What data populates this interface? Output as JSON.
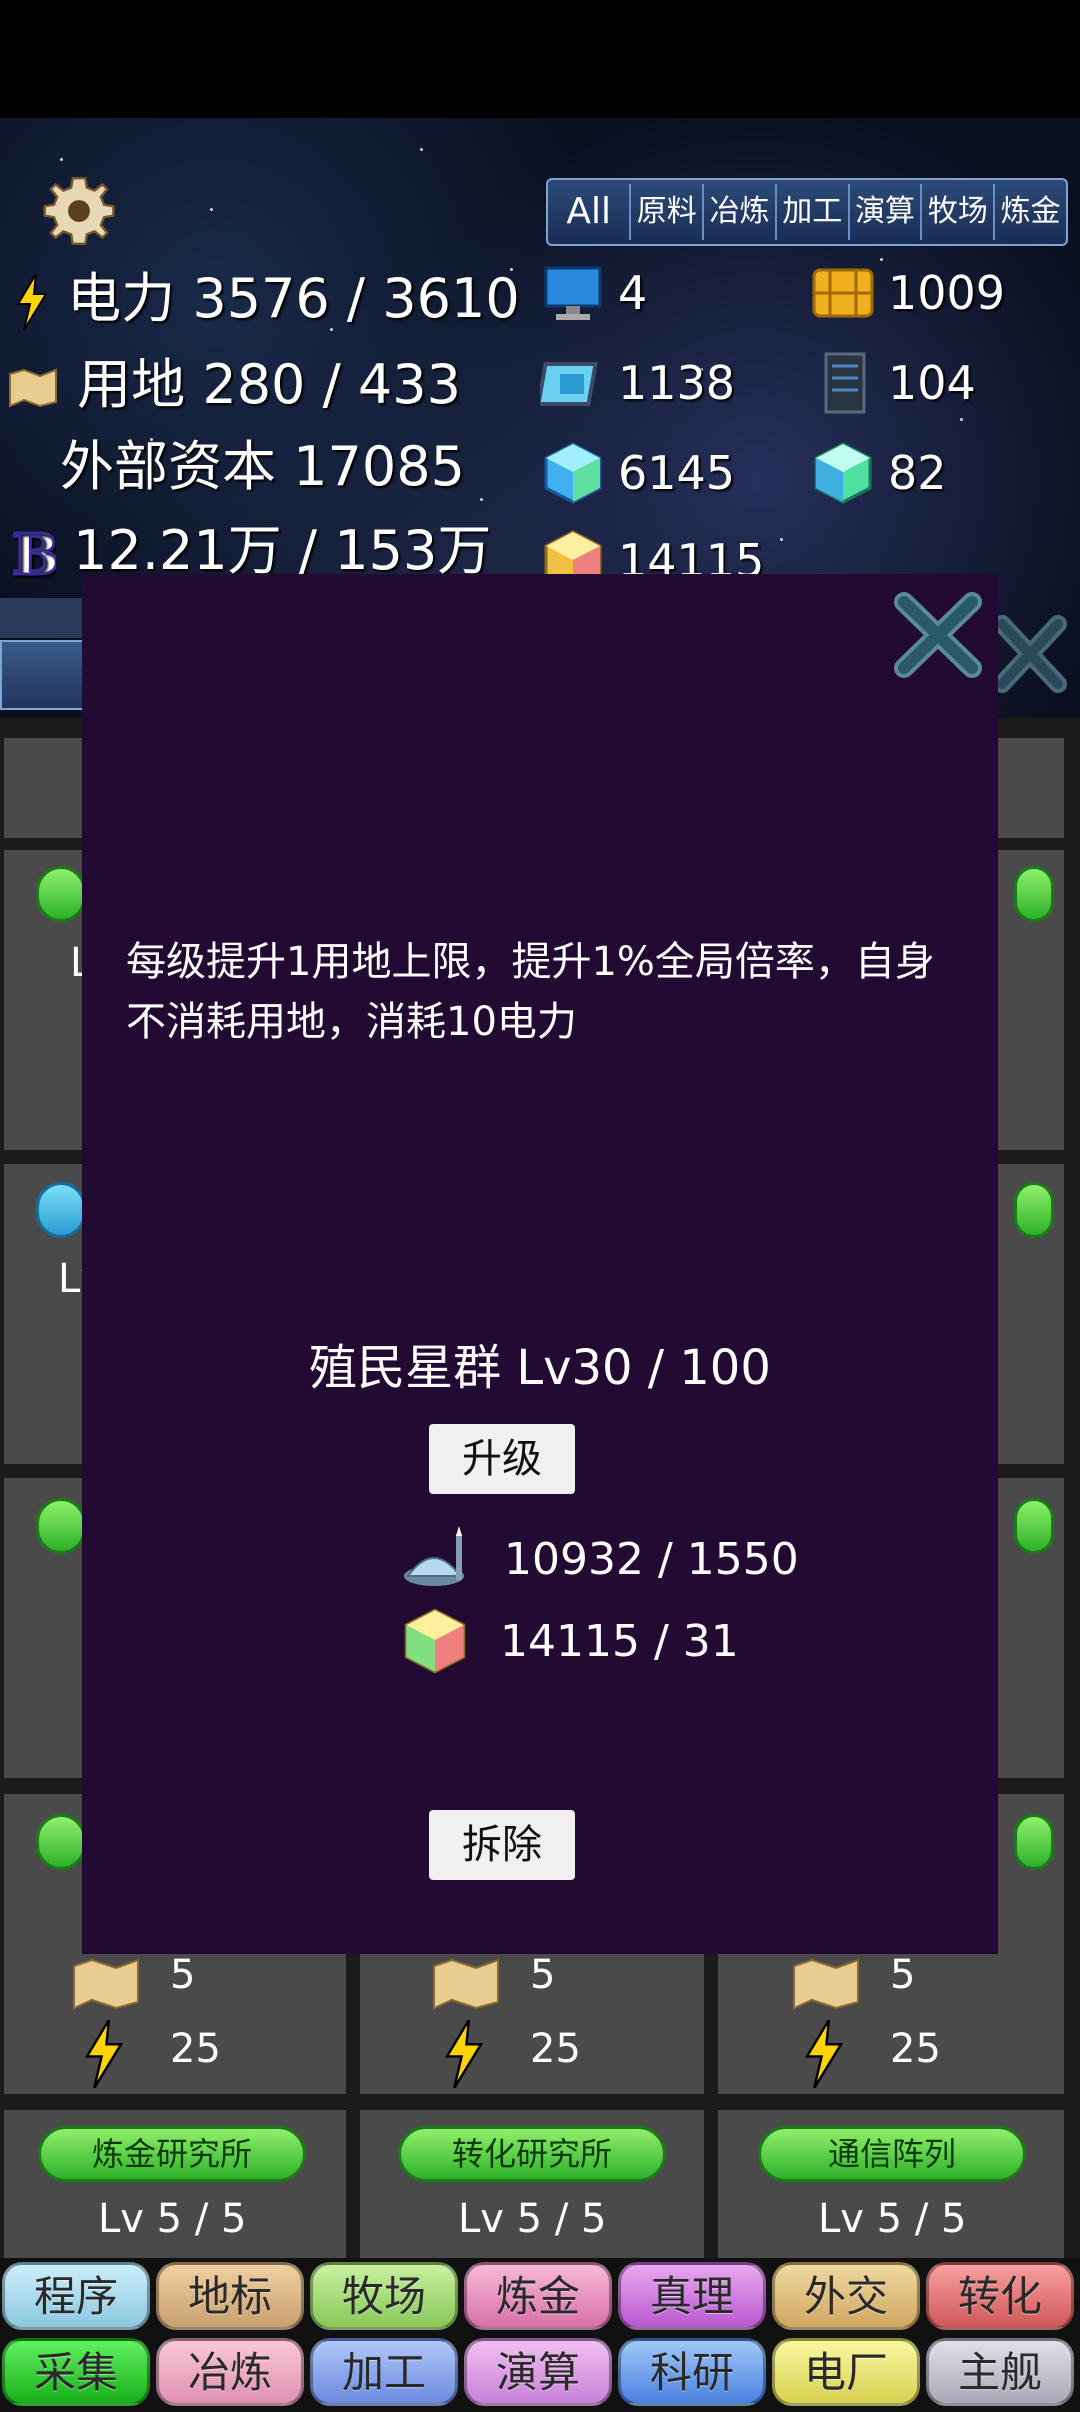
{
  "top_stats": {
    "power_label": "电力 3576 / 3610",
    "land_label": "用地 280 / 433",
    "capital_label": "外部资本 17085",
    "b_label": "12.21万 / 153万"
  },
  "category_tabs": [
    "All",
    "原料",
    "冶炼",
    "加工",
    "演算",
    "牧场",
    "炼金"
  ],
  "resources": {
    "computer": "4",
    "chip": "1009",
    "cpu": "1138",
    "server": "104",
    "crystal_blue": "6145",
    "crystal_green": "82",
    "crystal_rainbow": "14115"
  },
  "modal": {
    "description": "每级提升1用地上限，提升1%全局倍率，自身不消耗用地，消耗10电力",
    "building_name": "殖民星群 Lv30 / 100",
    "upgrade_label": "升级",
    "cost_1": "10932 / 1550",
    "cost_2": "14115 / 31",
    "demolish_label": "拆除"
  },
  "grid_cells": {
    "row_costs": [
      {
        "land": "5",
        "power": "25"
      },
      {
        "land": "5",
        "power": "25"
      },
      {
        "land": "5",
        "power": "25"
      }
    ],
    "buildings": [
      {
        "name": "炼金研究所",
        "level": "Lv 5 / 5"
      },
      {
        "name": "转化研究所",
        "level": "Lv 5 / 5"
      },
      {
        "name": "通信阵列",
        "level": "Lv 5 / 5"
      }
    ],
    "partial_labels": [
      "L",
      "Lv"
    ]
  },
  "bottom_tabs_row1": [
    "程序",
    "地标",
    "牧场",
    "炼金",
    "真理",
    "外交",
    "转化"
  ],
  "bottom_tabs_row2": [
    "采集",
    "冶炼",
    "加工",
    "演算",
    "科研",
    "电厂",
    "主舰"
  ],
  "colors": {
    "modal_bg": "#230a33",
    "accent_green": "#2fb02a"
  }
}
